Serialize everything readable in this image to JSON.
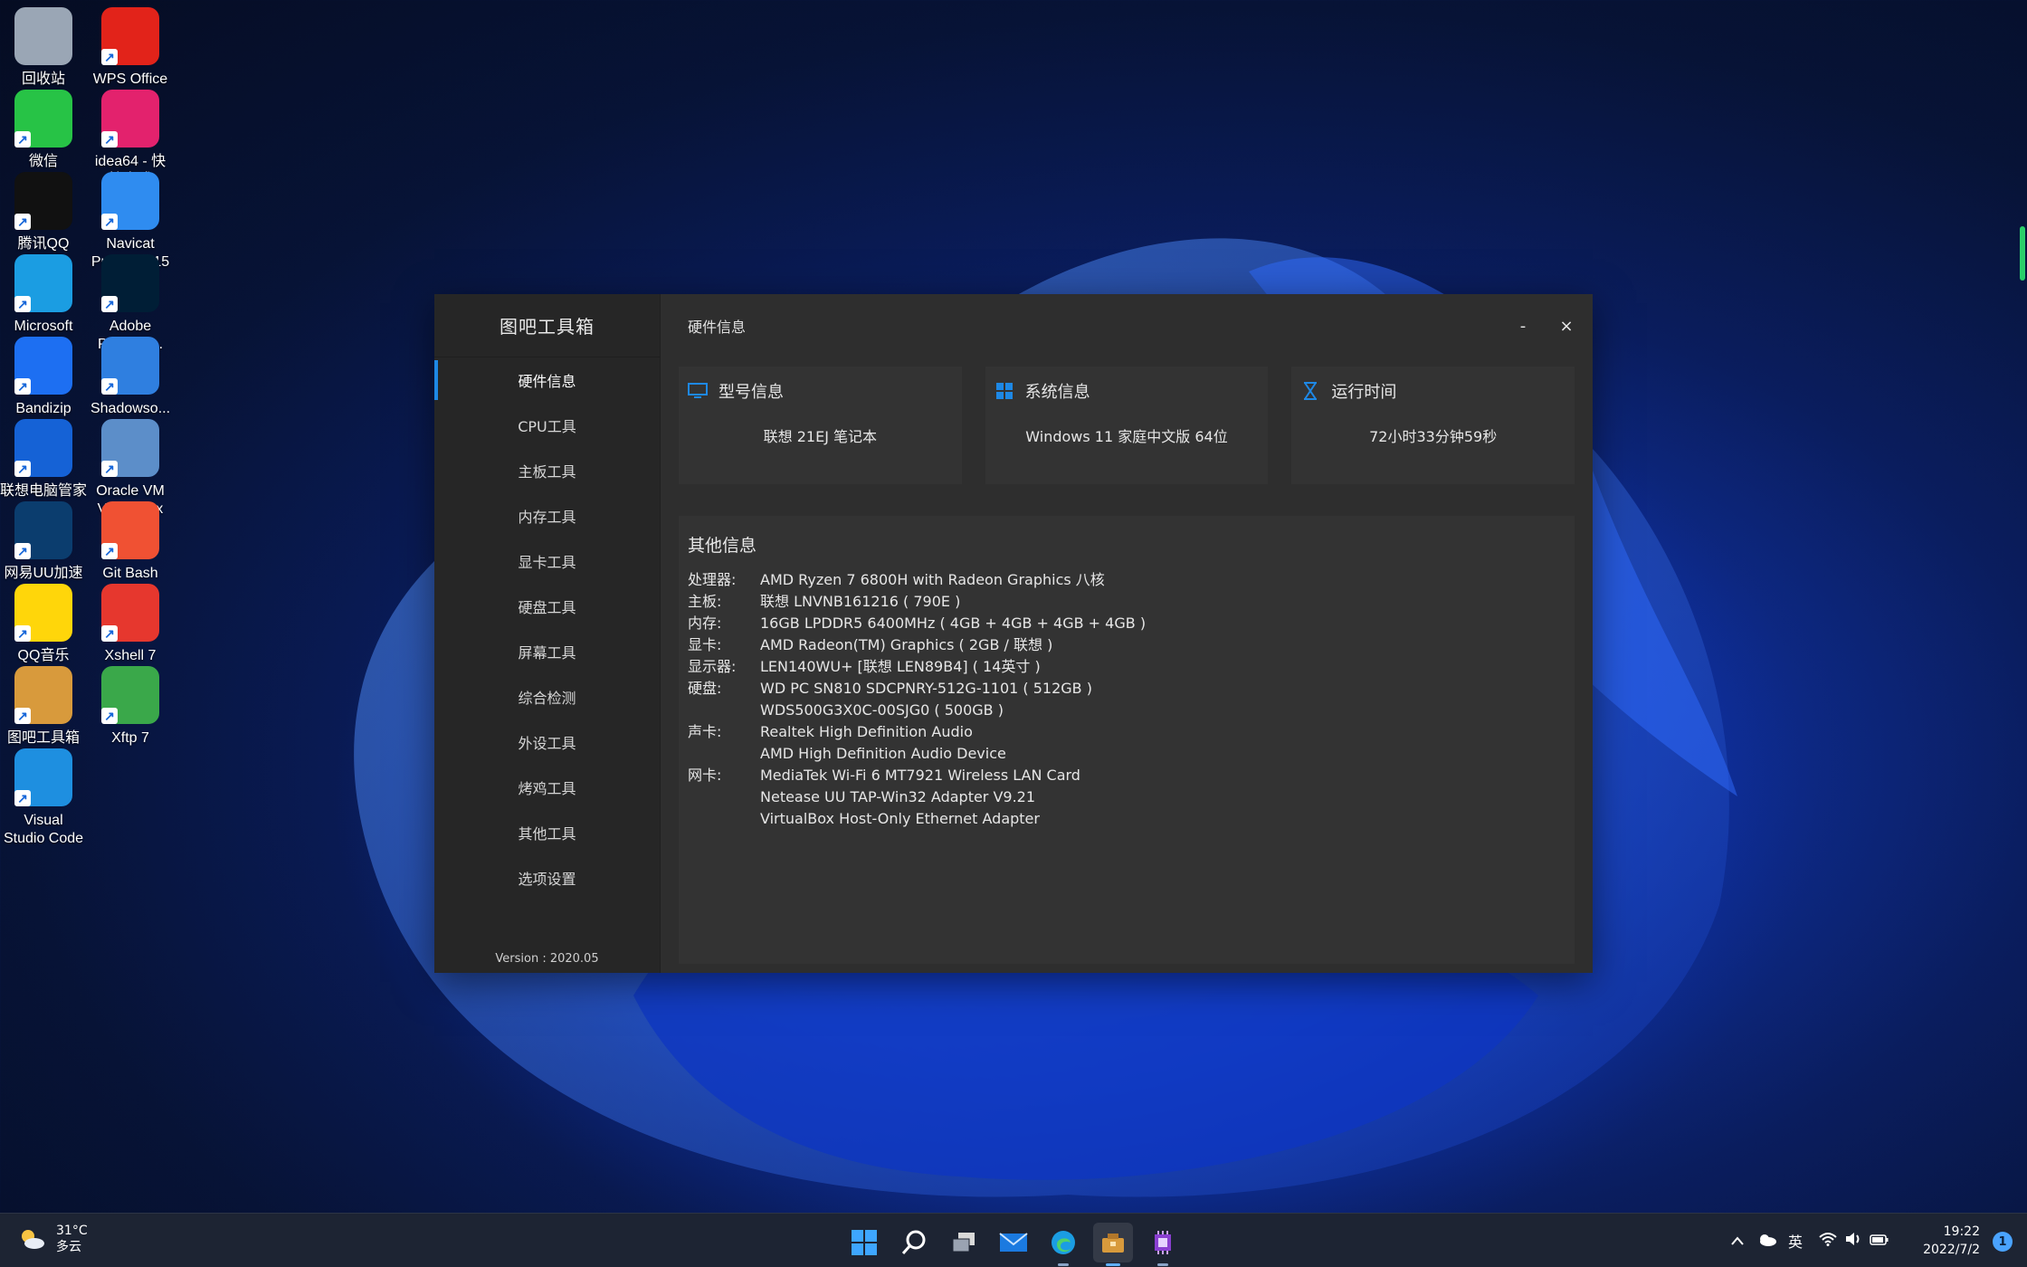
{
  "desktop_icons": [
    {
      "label": "回收站",
      "icon": "recycle-bin-icon",
      "color": "#9aa6b5"
    },
    {
      "label": "WPS Office",
      "icon": "wps-office-icon",
      "color": "#e2231a"
    },
    {
      "label": "微信",
      "icon": "wechat-icon",
      "color": "#27c346"
    },
    {
      "label": "idea64 - 快\n捷方式",
      "icon": "intellij-idea-icon",
      "color": "#e3226d"
    },
    {
      "label": "腾讯QQ",
      "icon": "qq-icon",
      "color": "#111111"
    },
    {
      "label": "Navicat\nPremium 15",
      "icon": "navicat-icon",
      "color": "#2f8cf0"
    },
    {
      "label": "Microsoft\nEdge",
      "icon": "edge-icon",
      "color": "#1b9de2"
    },
    {
      "label": "Adobe\nPhotosh...",
      "icon": "photoshop-icon",
      "color": "#001e36"
    },
    {
      "label": "Bandizip",
      "icon": "bandizip-icon",
      "color": "#1d6ff2"
    },
    {
      "label": "Shadowso...",
      "icon": "shadowsocks-icon",
      "color": "#2f7fe0"
    },
    {
      "label": "联想电脑管家",
      "icon": "lenovo-manager-icon",
      "color": "#1562d6"
    },
    {
      "label": "Oracle VM\nVirtualBox",
      "icon": "virtualbox-icon",
      "color": "#5c8ec9"
    },
    {
      "label": "网易UU加速\n器",
      "icon": "uu-accelerator-icon",
      "color": "#0b3d6e"
    },
    {
      "label": "Git Bash",
      "icon": "git-bash-icon",
      "color": "#f05133"
    },
    {
      "label": "QQ音乐",
      "icon": "qq-music-icon",
      "color": "#ffd60a"
    },
    {
      "label": "Xshell 7",
      "icon": "xshell-icon",
      "color": "#e6372e"
    },
    {
      "label": "图吧工具箱\n2022",
      "icon": "tuba-toolbox-icon",
      "color": "#d89a3c"
    },
    {
      "label": "Xftp 7",
      "icon": "xftp-icon",
      "color": "#3aa84a"
    },
    {
      "label": "Visual\nStudio Code",
      "icon": "vscode-icon",
      "color": "#1e8fe0"
    }
  ],
  "app": {
    "title": "图吧工具箱",
    "version": "Version : 2020.05",
    "nav": [
      "硬件信息",
      "CPU工具",
      "主板工具",
      "内存工具",
      "显卡工具",
      "硬盘工具",
      "屏幕工具",
      "综合检测",
      "外设工具",
      "烤鸡工具",
      "其他工具",
      "选项设置"
    ],
    "active_nav": 0,
    "page_title": "硬件信息",
    "minimize": "-",
    "close": "×",
    "accent": "#1e88e5",
    "cards": [
      {
        "title": "型号信息",
        "value": "联想 21EJ 笔记本",
        "icon": "monitor-icon"
      },
      {
        "title": "系统信息",
        "value": "Windows 11 家庭中文版 64位",
        "icon": "windows-logo-icon"
      },
      {
        "title": "运行时间",
        "value": "72小时33分钟59秒",
        "icon": "hourglass-icon"
      }
    ],
    "other_title": "其他信息",
    "other_rows": [
      {
        "key": "处理器:",
        "value": "AMD Ryzen 7 6800H with Radeon Graphics 八核"
      },
      {
        "key": "主板:",
        "value": "联想 LNVNB161216 ( 790E )"
      },
      {
        "key": "内存:",
        "value": "16GB LPDDR5 6400MHz ( 4GB + 4GB + 4GB + 4GB )"
      },
      {
        "key": "显卡:",
        "value": "AMD Radeon(TM) Graphics ( 2GB / 联想 )"
      },
      {
        "key": "显示器:",
        "value": "LEN140WU+ [联想 LEN89B4] ( 14英寸 )"
      },
      {
        "key": "硬盘:",
        "value": "WD PC SN810 SDCPNRY-512G-1101 ( 512GB )"
      },
      {
        "key": "",
        "value": "WDS500G3X0C-00SJG0 ( 500GB )"
      },
      {
        "key": "声卡:",
        "value": "Realtek High Definition Audio"
      },
      {
        "key": "",
        "value": "AMD High Definition Audio Device"
      },
      {
        "key": "网卡:",
        "value": "MediaTek Wi-Fi 6 MT7921 Wireless LAN Card"
      },
      {
        "key": "",
        "value": "Netease UU TAP-Win32 Adapter V9.21"
      },
      {
        "key": "",
        "value": "VirtualBox Host-Only Ethernet Adapter"
      }
    ]
  },
  "taskbar": {
    "weather_temp": "31°C",
    "weather_desc": "多云",
    "ime": "英",
    "time": "19:22",
    "date": "2022/7/2",
    "notification_count": "1"
  }
}
